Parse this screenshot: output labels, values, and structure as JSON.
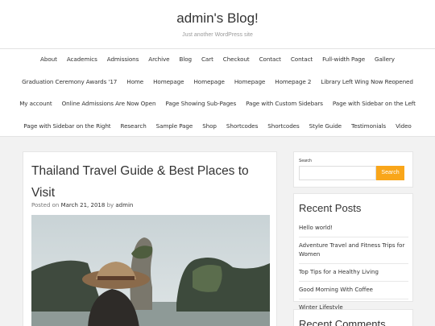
{
  "site": {
    "title": "admin's Blog!",
    "description": "Just another WordPress site"
  },
  "nav": {
    "row1": [
      "About",
      "Academics",
      "Admissions",
      "Archive",
      "Blog",
      "Cart",
      "Checkout",
      "Contact",
      "Contact",
      "Full-width Page",
      "Gallery"
    ],
    "row2": [
      "Graduation Ceremony Awards '17",
      "Home",
      "Homepage",
      "Homepage",
      "Homepage",
      "Homepage 2",
      "Library Left Wing Now Reopened"
    ],
    "row3": [
      "My account",
      "Online Admissions Are Now Open",
      "Page Showing Sub-Pages",
      "Page with Custom Sidebars",
      "Page with Sidebar on the Left"
    ],
    "row4": [
      "Page with Sidebar on the Right",
      "Research",
      "Sample Page",
      "Shop",
      "Shortcodes",
      "Shortcodes",
      "Style Guide",
      "Testimonials",
      "Video"
    ]
  },
  "post": {
    "title": "Thailand Travel Guide & Best Places to Visit",
    "posted_on": "Posted on",
    "date": "March 21, 2018",
    "by": "by",
    "author": "admin"
  },
  "search": {
    "label": "Search",
    "button": "Search",
    "placeholder": ""
  },
  "recent": {
    "title": "Recent Posts",
    "items": [
      "Hello world!",
      "Adventure Travel and Fitness Trips for Women",
      "Top Tips for a Healthy Living",
      "Good Morning With Coffee",
      "Winter Lifestyle"
    ]
  },
  "comments": {
    "title": "Recent Comments"
  },
  "colors": {
    "accent": "#f9a61a"
  }
}
